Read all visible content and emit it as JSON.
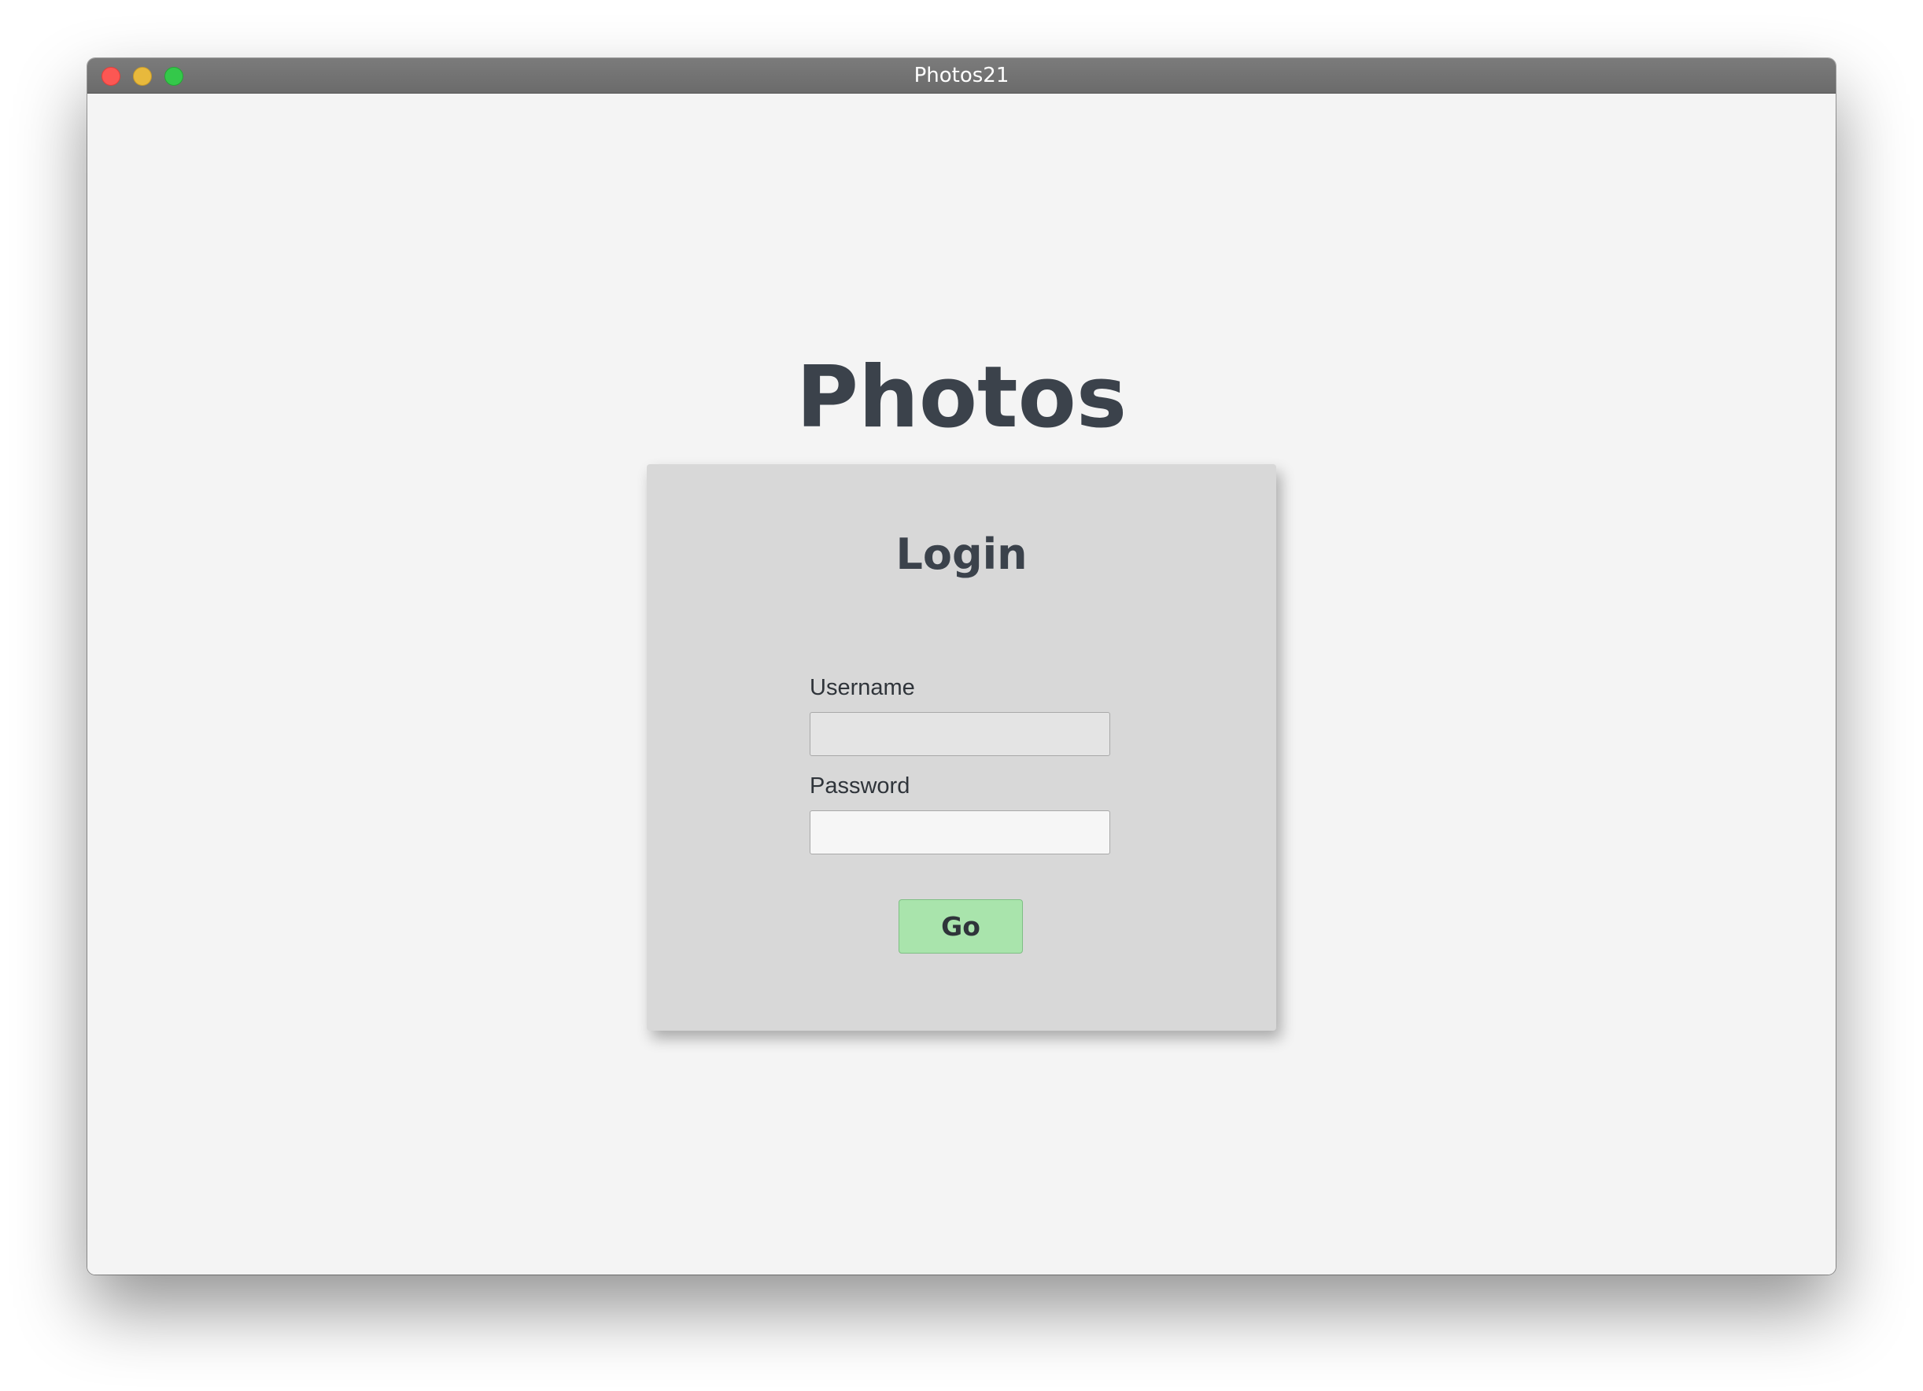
{
  "window": {
    "title": "Photos21"
  },
  "app": {
    "title": "Photos"
  },
  "login": {
    "title": "Login",
    "username_label": "Username",
    "username_value": "",
    "password_label": "Password",
    "password_value": "",
    "submit_label": "Go"
  },
  "colors": {
    "background": "#f4f4f4",
    "card": "#d8d8d8",
    "text": "#3b424b",
    "button": "#a9e4ac",
    "close": "#fc5753",
    "minimize": "#e8b93c",
    "maximize": "#34c84a"
  }
}
